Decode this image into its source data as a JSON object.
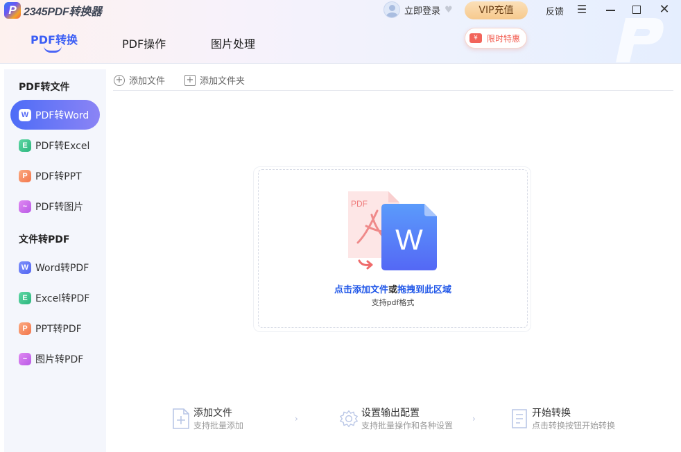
{
  "app": {
    "logo_mark": "P",
    "title": "2345PDF转换器"
  },
  "header": {
    "login_label": "立即登录",
    "vip_label": "VIP充值",
    "feedback_label": "反馈",
    "promo_label": "限时特惠",
    "promo_icon_text": "¥",
    "tabs": [
      {
        "label": "PDF转换",
        "active": true
      },
      {
        "label": "PDF操作",
        "active": false
      },
      {
        "label": "图片处理",
        "active": false
      }
    ]
  },
  "sidebar": {
    "section_1": "PDF转文件",
    "section_2": "文件转PDF",
    "items": [
      {
        "label": "PDF转Word",
        "icon": "word-icon",
        "glyph": "W",
        "active": true
      },
      {
        "label": "PDF转Excel",
        "icon": "excel-icon",
        "glyph": "E",
        "active": false
      },
      {
        "label": "PDF转PPT",
        "icon": "ppt-icon",
        "glyph": "P",
        "active": false
      },
      {
        "label": "PDF转图片",
        "icon": "image-icon",
        "glyph": "~",
        "active": false
      },
      {
        "label": "Word转PDF",
        "icon": "word-icon",
        "glyph": "W",
        "active": false
      },
      {
        "label": "Excel转PDF",
        "icon": "excel-icon",
        "glyph": "E",
        "active": false
      },
      {
        "label": "PPT转PDF",
        "icon": "ppt-icon",
        "glyph": "P",
        "active": false
      },
      {
        "label": "图片转PDF",
        "icon": "image-icon",
        "glyph": "~",
        "active": false
      }
    ]
  },
  "toolbar": {
    "add_file": "添加文件",
    "add_folder": "添加文件夹"
  },
  "dropzone": {
    "illus_pdf_label": "PDF",
    "illus_word_glyph": "W",
    "main_part1": "点击添加文件",
    "main_or": "或",
    "main_part2": "拖拽到此区域",
    "sub": "支持pdf格式"
  },
  "steps": [
    {
      "title": "添加文件",
      "desc": "支持批量添加"
    },
    {
      "title": "设置输出配置",
      "desc": "支持批量操作和各种设置"
    },
    {
      "title": "开始转换",
      "desc": "点击转换按钮开始转换"
    }
  ],
  "colors": {
    "accent": "#3b5ef5",
    "active_item_gradient_start": "#4d6cf7",
    "active_item_gradient_end": "#8b84f5",
    "drop_link": "#1f56e8",
    "promo_red": "#f25a4d",
    "vip_gold": "#f6c98d"
  }
}
